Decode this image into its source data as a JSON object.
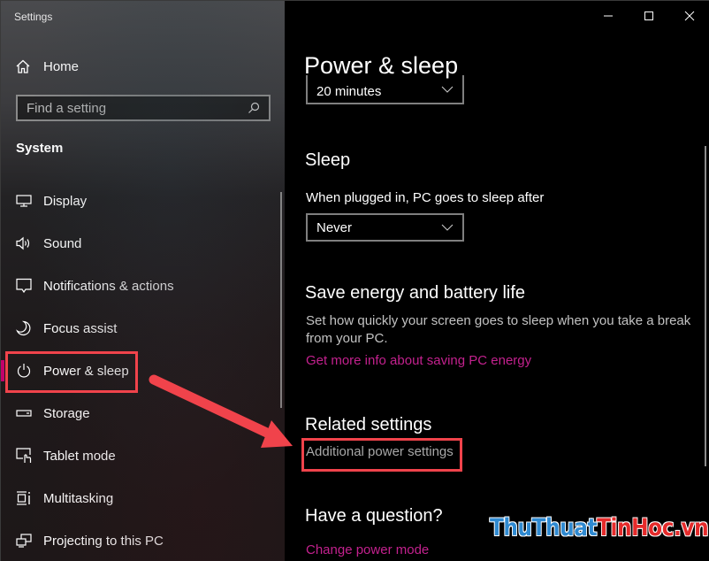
{
  "window": {
    "app_title": "Settings",
    "controls": [
      {
        "name": "minimize",
        "icon": "minimize-icon"
      },
      {
        "name": "maximize",
        "icon": "maximize-icon"
      },
      {
        "name": "close",
        "icon": "close-icon"
      }
    ]
  },
  "sidebar": {
    "home_label": "Home",
    "search_placeholder": "Find a setting",
    "section_title": "System",
    "items": [
      {
        "label": "Display",
        "icon": "display-icon"
      },
      {
        "label": "Sound",
        "icon": "sound-icon"
      },
      {
        "label": "Notifications & actions",
        "icon": "notifications-icon"
      },
      {
        "label": "Focus assist",
        "icon": "moon-icon"
      },
      {
        "label": "Power & sleep",
        "icon": "power-icon",
        "active": true
      },
      {
        "label": "Storage",
        "icon": "storage-icon"
      },
      {
        "label": "Tablet mode",
        "icon": "tablet-mode-icon"
      },
      {
        "label": "Multitasking",
        "icon": "multitasking-icon"
      },
      {
        "label": "Projecting to this PC",
        "icon": "projecting-icon"
      }
    ]
  },
  "main": {
    "page_title": "Power & sleep",
    "screen_dropdown_value": "20 minutes",
    "sleep": {
      "heading": "Sleep",
      "label": "When plugged in, PC goes to sleep after",
      "dropdown_value": "Never"
    },
    "save_energy": {
      "heading": "Save energy and battery life",
      "description": "Set how quickly your screen goes to sleep when you take a break from your PC.",
      "link": "Get more info about saving PC energy"
    },
    "related": {
      "heading": "Related settings",
      "link": "Additional power settings"
    },
    "question": {
      "heading": "Have a question?",
      "link": "Change power mode"
    }
  },
  "annotations": {
    "highlight_color": "#f0434b",
    "accent_color": "#c3006b",
    "link_color": "#c3218e"
  },
  "watermark": {
    "part1": "ThuThuat",
    "part2": "TinHoc.vn"
  }
}
